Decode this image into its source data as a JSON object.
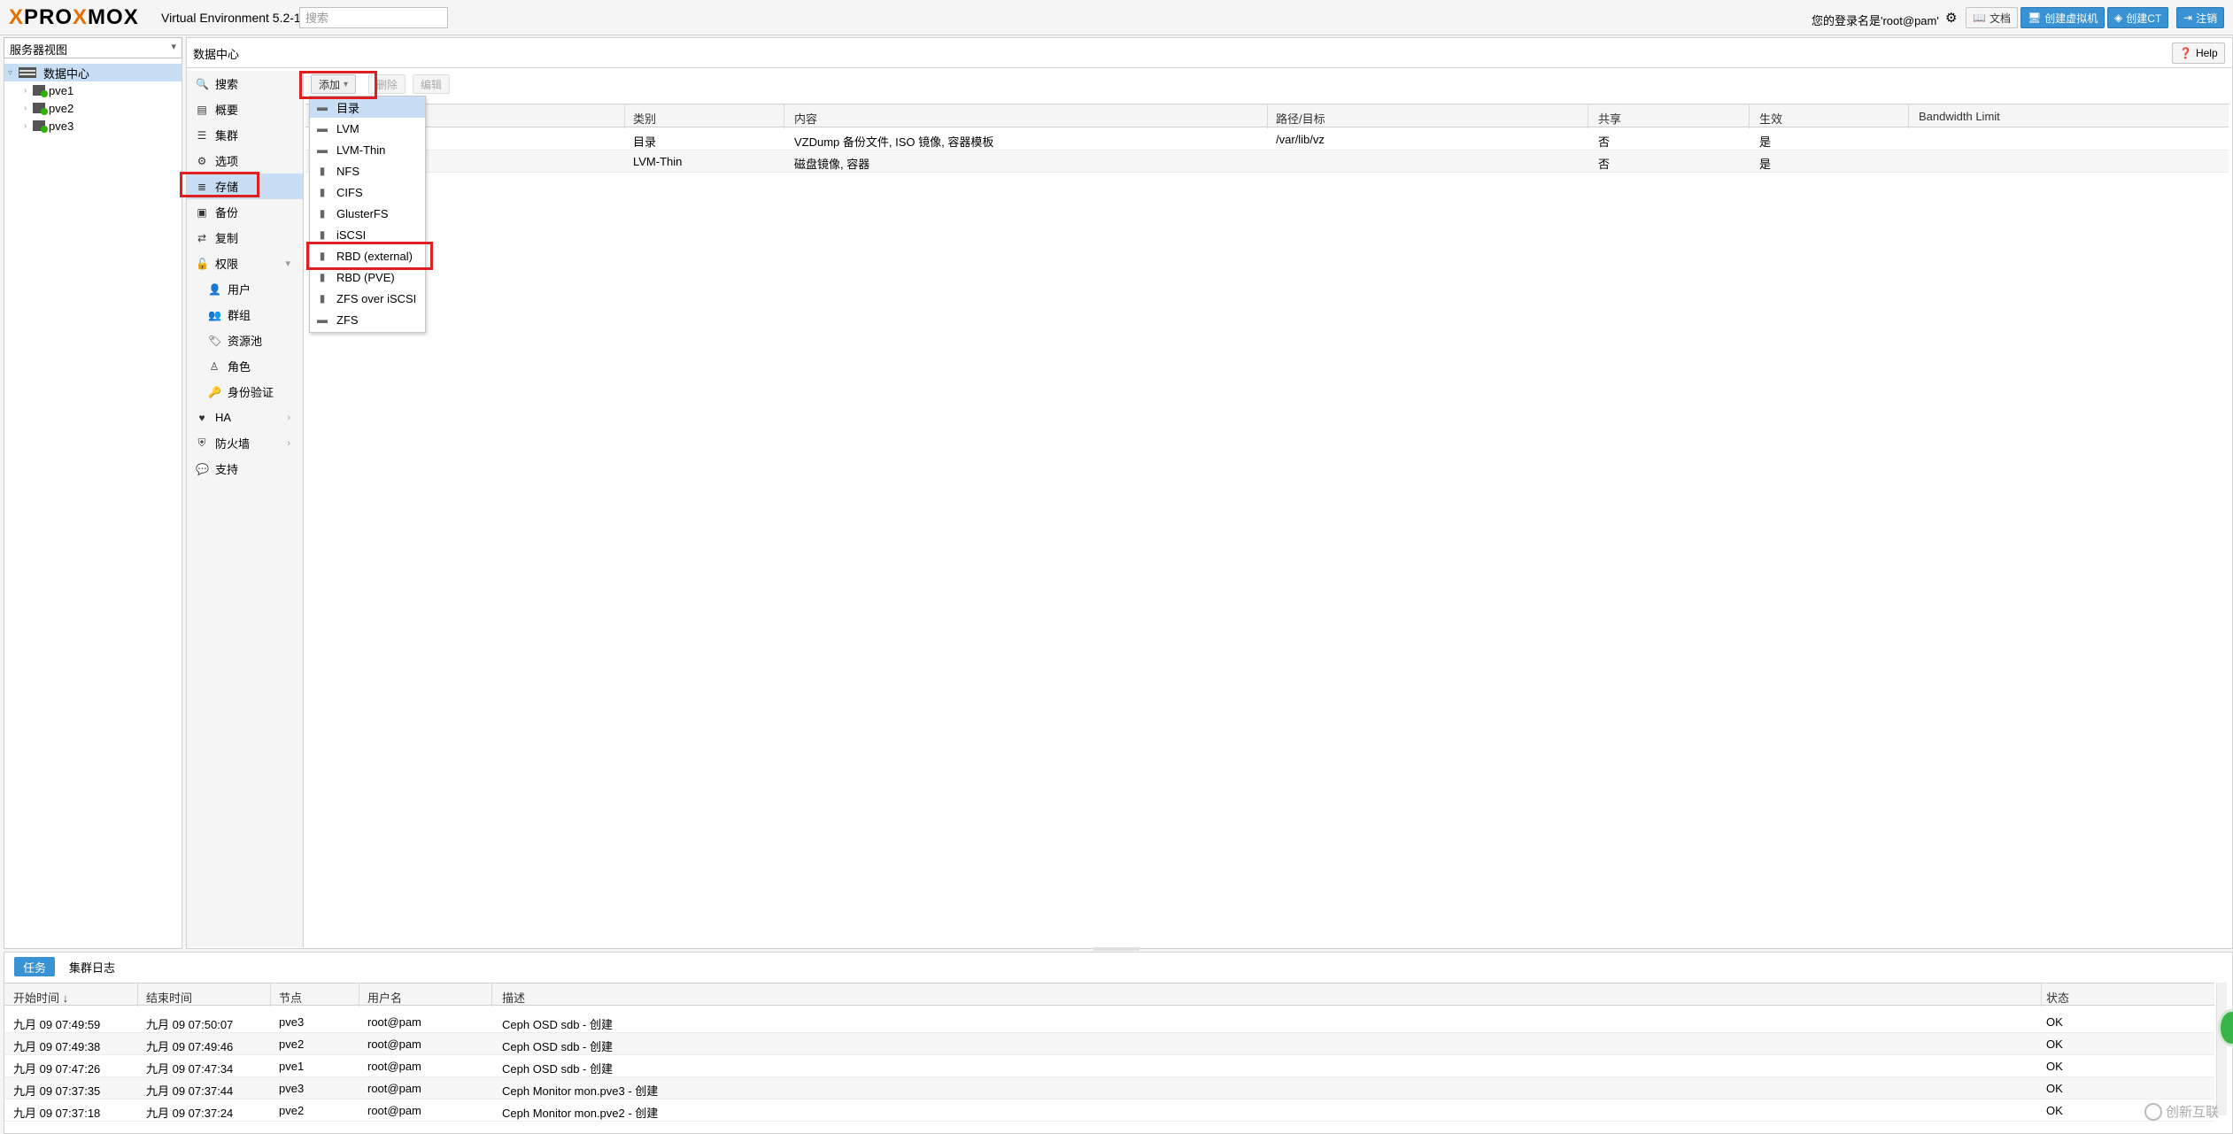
{
  "topbar": {
    "logo_pre": "PRO",
    "logo_x": "X",
    "logo_post": "MOX",
    "version": "Virtual Environment 5.2-1",
    "search_placeholder": "搜索",
    "login_text": "您的登录名是'root@pam'",
    "docs_label": "文档",
    "create_vm_label": "创建虚拟机",
    "create_ct_label": "创建CT",
    "logout_label": "注销"
  },
  "tree": {
    "view_label": "服务器视图",
    "datacenter": "数据中心",
    "nodes": [
      "pve1",
      "pve2",
      "pve3"
    ]
  },
  "content": {
    "title": "数据中心",
    "help_label": "Help"
  },
  "nav": [
    {
      "label": "搜索",
      "icon": "search-icon"
    },
    {
      "label": "概要",
      "icon": "book-icon"
    },
    {
      "label": "集群",
      "icon": "server-icon"
    },
    {
      "label": "选项",
      "icon": "gear-icon"
    },
    {
      "label": "存储",
      "icon": "database-icon"
    },
    {
      "label": "备份",
      "icon": "floppy-icon"
    },
    {
      "label": "复制",
      "icon": "retweet-icon"
    },
    {
      "label": "权限",
      "icon": "unlock-icon"
    },
    {
      "label": "用户",
      "icon": "user-icon"
    },
    {
      "label": "群组",
      "icon": "users-icon"
    },
    {
      "label": "资源池",
      "icon": "tags-icon"
    },
    {
      "label": "角色",
      "icon": "male-icon"
    },
    {
      "label": "身份验证",
      "icon": "key-icon"
    },
    {
      "label": "HA",
      "icon": "heartbeat-icon"
    },
    {
      "label": "防火墙",
      "icon": "shield-icon"
    },
    {
      "label": "支持",
      "icon": "comments-icon"
    }
  ],
  "toolbar": {
    "add_label": "添加",
    "remove_label": "删除",
    "edit_label": "编辑"
  },
  "storage_grid": {
    "columns": [
      "类别",
      "内容",
      "路径/目标",
      "共享",
      "生效",
      "Bandwidth Limit"
    ],
    "rows": [
      {
        "type": "目录",
        "content": "VZDump 备份文件, ISO 镜像, 容器模板",
        "path": "/var/lib/vz",
        "shared": "否",
        "enabled": "是"
      },
      {
        "type": "LVM-Thin",
        "content": "磁盘镜像, 容器",
        "path": "",
        "shared": "否",
        "enabled": "是"
      }
    ]
  },
  "add_menu": [
    {
      "label": "目录",
      "icon": "folder-icon"
    },
    {
      "label": "LVM",
      "icon": "folder-icon"
    },
    {
      "label": "LVM-Thin",
      "icon": "folder-icon"
    },
    {
      "label": "NFS",
      "icon": "building-icon"
    },
    {
      "label": "CIFS",
      "icon": "building-icon"
    },
    {
      "label": "GlusterFS",
      "icon": "building-icon"
    },
    {
      "label": "iSCSI",
      "icon": "building-icon"
    },
    {
      "label": "RBD (external)",
      "icon": "building-icon"
    },
    {
      "label": "RBD (PVE)",
      "icon": "building-icon"
    },
    {
      "label": "ZFS over iSCSI",
      "icon": "building-icon"
    },
    {
      "label": "ZFS",
      "icon": "folder-icon"
    }
  ],
  "bottom": {
    "tab_tasks": "任务",
    "tab_cluster_log": "集群日志",
    "columns": [
      "开始时间 ↓",
      "结束时间",
      "节点",
      "用户名",
      "描述",
      "状态"
    ],
    "rows": [
      {
        "start": "九月 09 07:49:59",
        "end": "九月 09 07:50:07",
        "node": "pve3",
        "user": "root@pam",
        "desc": "Ceph OSD sdb - 创建",
        "status": "OK"
      },
      {
        "start": "九月 09 07:49:38",
        "end": "九月 09 07:49:46",
        "node": "pve2",
        "user": "root@pam",
        "desc": "Ceph OSD sdb - 创建",
        "status": "OK"
      },
      {
        "start": "九月 09 07:47:26",
        "end": "九月 09 07:47:34",
        "node": "pve1",
        "user": "root@pam",
        "desc": "Ceph OSD sdb - 创建",
        "status": "OK"
      },
      {
        "start": "九月 09 07:37:35",
        "end": "九月 09 07:37:44",
        "node": "pve3",
        "user": "root@pam",
        "desc": "Ceph Monitor mon.pve3 - 创建",
        "status": "OK"
      },
      {
        "start": "九月 09 07:37:18",
        "end": "九月 09 07:37:24",
        "node": "pve2",
        "user": "root@pam",
        "desc": "Ceph Monitor mon.pve2 - 创建",
        "status": "OK"
      }
    ]
  },
  "watermark": "创新互联",
  "colors": {
    "accent": "#3892d4",
    "highlight": "#e02020",
    "selection": "#c8def5",
    "logo_x": "#e57000"
  }
}
